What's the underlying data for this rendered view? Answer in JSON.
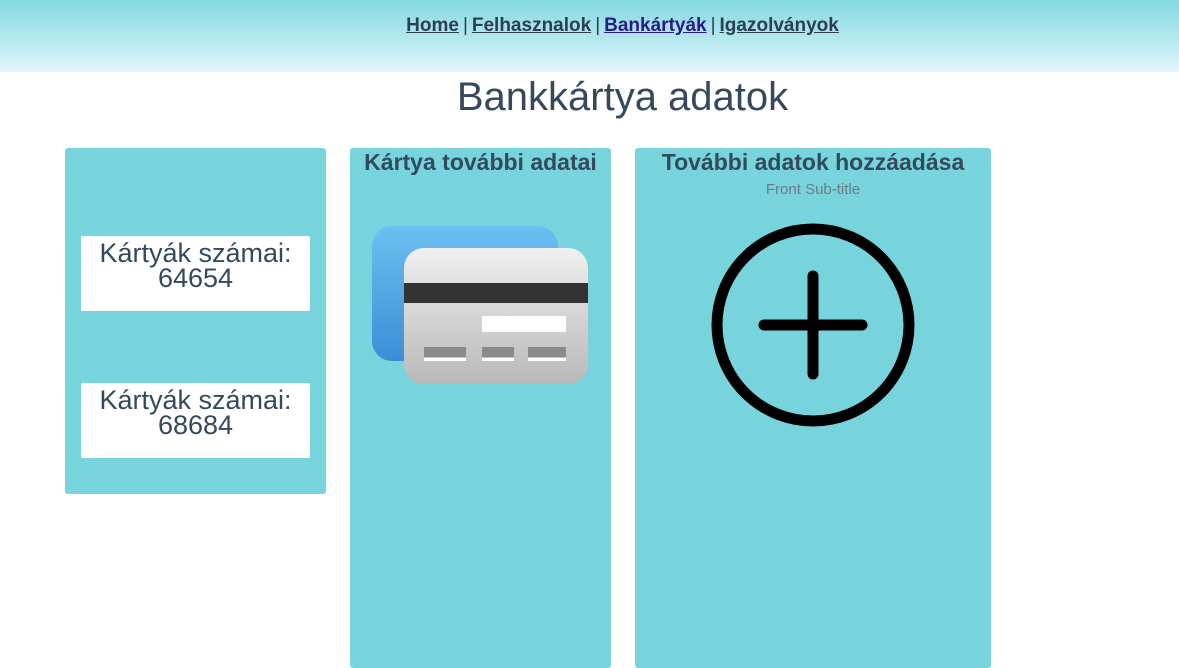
{
  "nav": {
    "items": [
      {
        "label": "Home"
      },
      {
        "label": "Felhasznalok"
      },
      {
        "label": "Bankártyák",
        "active": true
      },
      {
        "label": "Igazolványok"
      }
    ],
    "separator": "|"
  },
  "page": {
    "title": "Bankkártya adatok"
  },
  "cards_panel": {
    "cards": [
      {
        "label": "Kártyák számai:",
        "number": "64654"
      },
      {
        "label": "Kártyák számai:",
        "number": "68684"
      }
    ]
  },
  "details_panel": {
    "title": "Kártya további adatai",
    "icon": "credit-card-icon"
  },
  "add_panel": {
    "title": "További adatok hozzáadása",
    "subtitle": "Front Sub-title",
    "icon": "plus-circle-icon"
  },
  "colors": {
    "panel": "#78d4dc",
    "header_gradient_top": "#86d8e0",
    "header_gradient_bottom": "#e2f7fa",
    "text": "#34495e",
    "active_link": "#2c1a8a"
  }
}
